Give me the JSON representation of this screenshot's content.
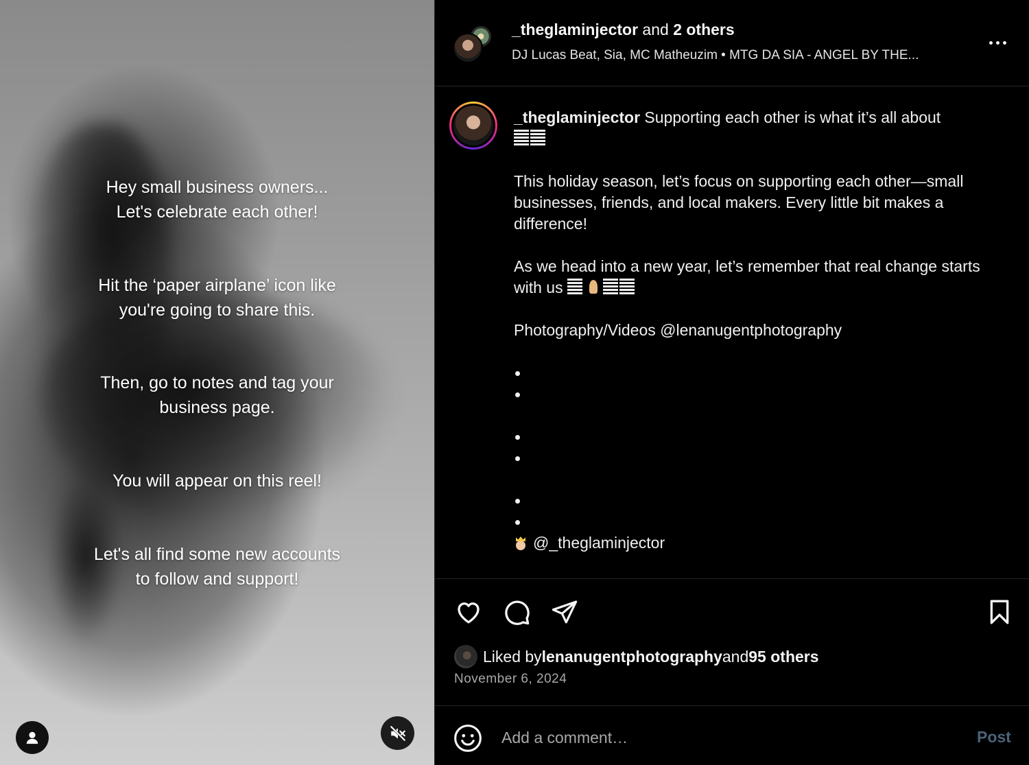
{
  "media": {
    "overlay_lines": [
      "Hey small business owners...\nLet's celebrate each other!",
      "Hit the ‘paper airplane’ icon like\nyou're going to share this.",
      "Then, go to notes and tag your\nbusiness page.",
      "You will appear on this reel!",
      "Let's all find some new accounts\nto follow and support!"
    ],
    "user_icon": "user-icon",
    "mute_icon": "muted-speaker-icon"
  },
  "header": {
    "username": "_theglaminjector",
    "joiner": " and ",
    "others": "2 others",
    "audio": "DJ Lucas Beat, Sia, MC Matheuzim • MTG DA SIA - ANGEL BY THE...",
    "more_icon": "more-options-icon"
  },
  "caption": {
    "username": "_theglaminjector",
    "first_line": " Supporting each other is what it’s all about",
    "para1": "This holiday season, let’s focus on supporting each other—small businesses, friends, and local makers. Every little bit makes a difference!",
    "para2_start": "As we head into a new year, let’s remember that real change starts with us ",
    "credit": "Photography/Videos @lenanugentphotography",
    "mention": "@_theglaminjector"
  },
  "actions": {
    "like_icon": "heart-icon",
    "comment_icon": "comment-icon",
    "share_icon": "paper-airplane-icon",
    "save_icon": "bookmark-icon",
    "liked_by_prefix": "Liked by ",
    "liked_by_user": "lenanugentphotography",
    "liked_by_joiner": " and ",
    "liked_by_others": "95 others",
    "date": "November 6, 2024"
  },
  "comment": {
    "placeholder": "Add a comment…",
    "post_label": "Post",
    "emoji_icon": "smiley-icon"
  },
  "colors": {
    "background": "#000000",
    "divider": "#262626",
    "muted_text": "#a8a8a8",
    "post_disabled": "#4a6378"
  }
}
